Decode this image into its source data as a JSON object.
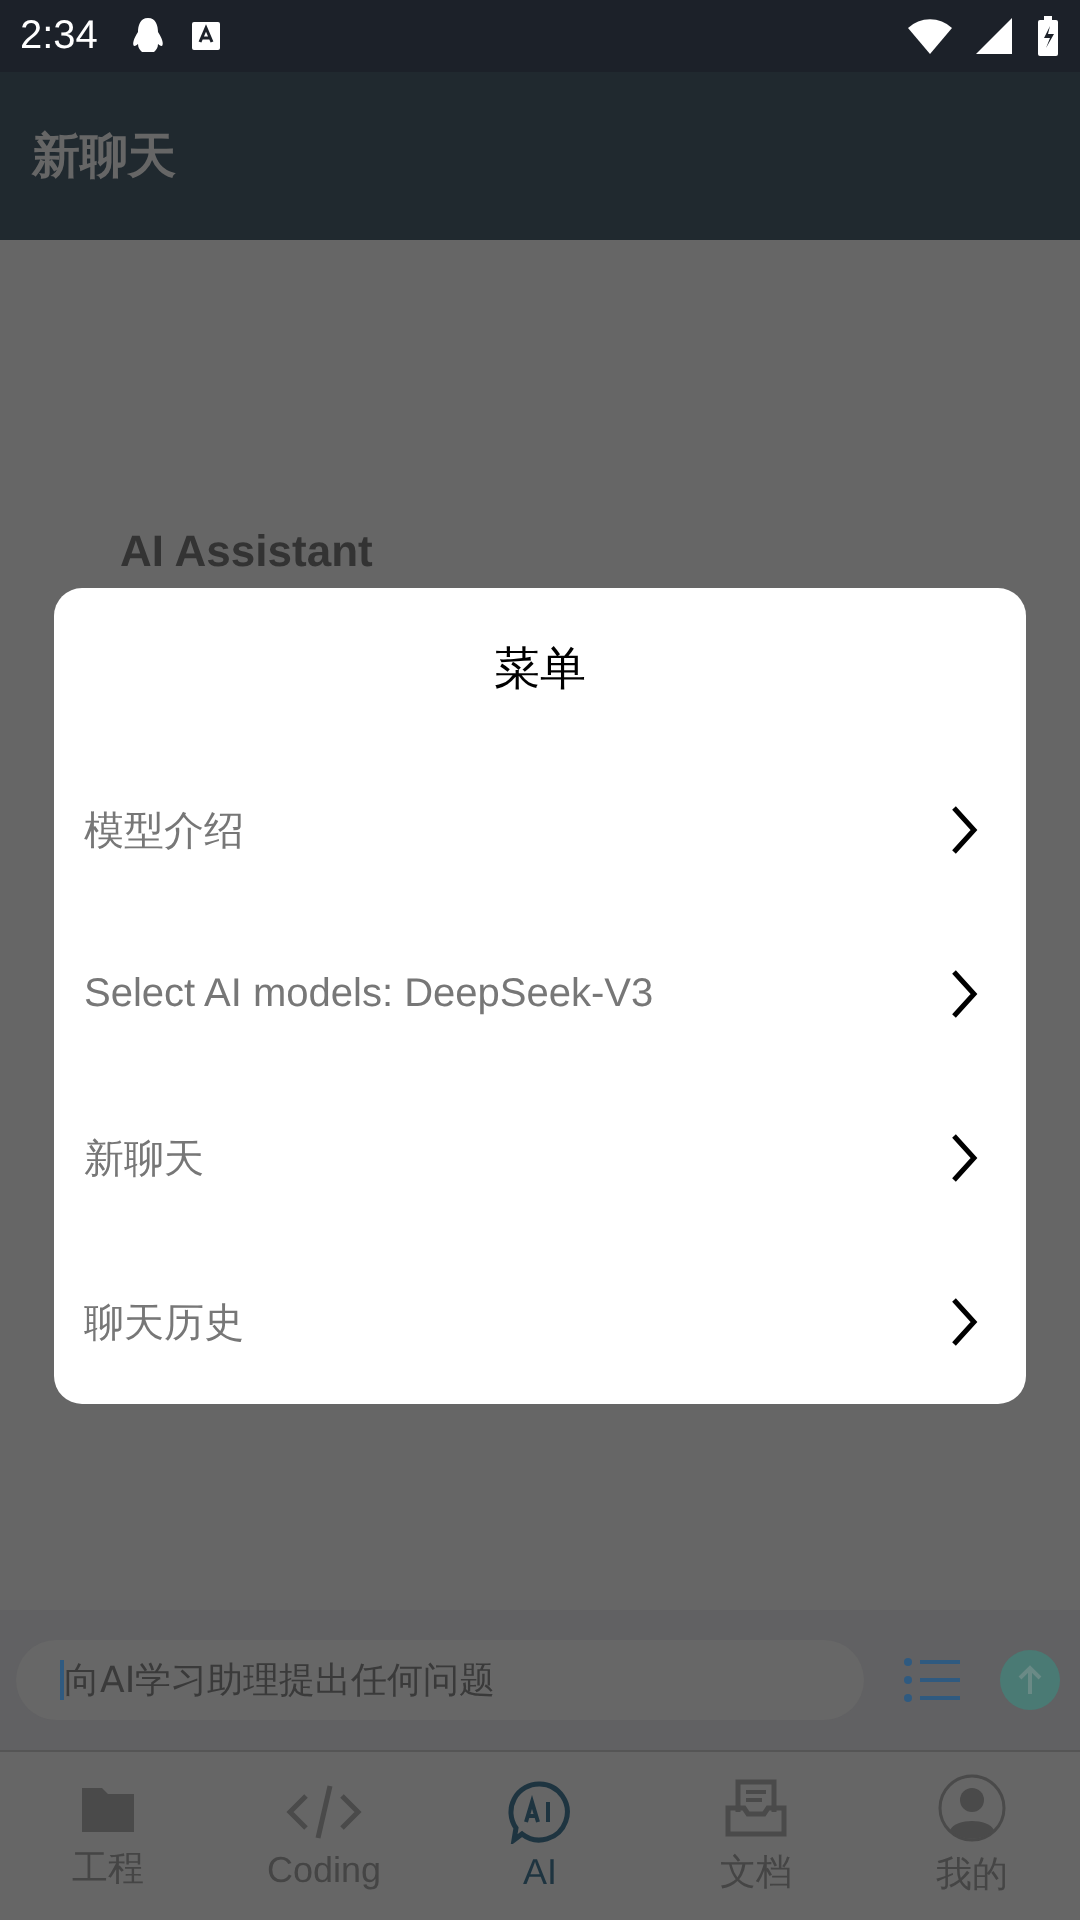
{
  "status_bar": {
    "time": "2:34"
  },
  "app_bar": {
    "title": "新聊天"
  },
  "content": {
    "heading": "AI Assistant"
  },
  "dialog": {
    "title": "菜单",
    "items": [
      {
        "label": "模型介绍"
      },
      {
        "label": "Select AI models: DeepSeek-V3"
      },
      {
        "label": "新聊天"
      },
      {
        "label": "聊天历史"
      }
    ]
  },
  "input": {
    "placeholder": "向AI学习助理提出任何问题"
  },
  "nav": [
    {
      "kind": "folder",
      "label": "工程",
      "selected": false
    },
    {
      "kind": "code",
      "label": "Coding",
      "selected": false
    },
    {
      "kind": "ai",
      "label": "AI",
      "selected": true
    },
    {
      "kind": "doc",
      "label": "文档",
      "selected": false
    },
    {
      "kind": "user",
      "label": "我的",
      "selected": false
    }
  ]
}
